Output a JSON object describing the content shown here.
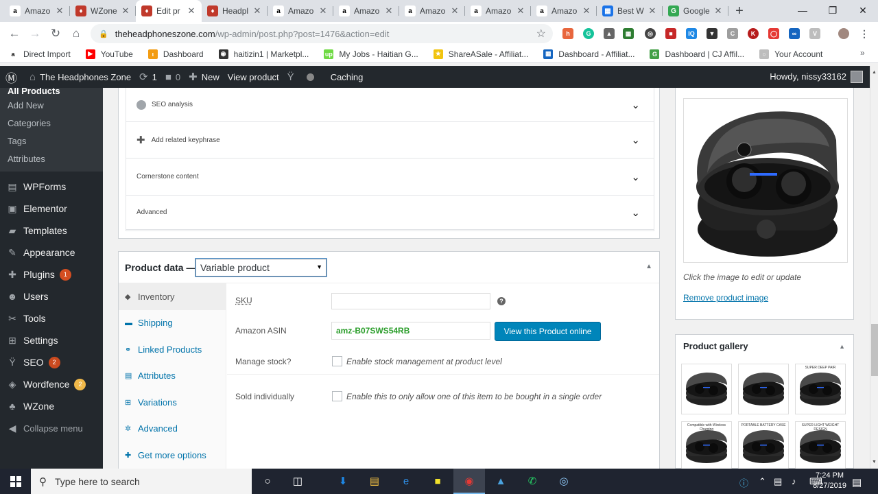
{
  "browser": {
    "tabs": [
      {
        "title": "Amazo",
        "icon": "amazon-icon",
        "color": "#ffffff",
        "glyph": "a",
        "fg": "#000000"
      },
      {
        "title": "WZone",
        "icon": "wzone-icon",
        "color": "#c0392b",
        "glyph": "♦",
        "fg": "#ffffff"
      },
      {
        "title": "Edit pr",
        "icon": "wzone-icon",
        "color": "#c0392b",
        "glyph": "♦",
        "fg": "#ffffff",
        "active": true
      },
      {
        "title": "Headpl",
        "icon": "wzone-icon",
        "color": "#c0392b",
        "glyph": "♦",
        "fg": "#ffffff"
      },
      {
        "title": "Amazo",
        "icon": "amazon-icon",
        "color": "#ffffff",
        "glyph": "a",
        "fg": "#000000"
      },
      {
        "title": "Amazo",
        "icon": "amazon-icon",
        "color": "#ffffff",
        "glyph": "a",
        "fg": "#000000"
      },
      {
        "title": "Amazo",
        "icon": "amazon-icon",
        "color": "#ffffff",
        "glyph": "a",
        "fg": "#000000"
      },
      {
        "title": "Amazo",
        "icon": "amazon-icon",
        "color": "#ffffff",
        "glyph": "a",
        "fg": "#000000"
      },
      {
        "title": "Amazo",
        "icon": "amazon-icon",
        "color": "#ffffff",
        "glyph": "a",
        "fg": "#000000"
      },
      {
        "title": "Best W",
        "icon": "best-icon",
        "color": "#1a73e8",
        "glyph": "▦",
        "fg": "#ffffff"
      },
      {
        "title": "Google",
        "icon": "google-icon",
        "color": "#34a853",
        "glyph": "G",
        "fg": "#ffffff"
      }
    ],
    "url_host": "theheadphoneszone.com",
    "url_path": "/wp-admin/post.php?post=1476&action=edit",
    "bookmarks": [
      {
        "label": "Direct Import",
        "color": "#ffffff",
        "glyph": "a",
        "fg": "#000000"
      },
      {
        "label": "YouTube",
        "color": "#ff0000",
        "glyph": "▶",
        "fg": "#ffffff"
      },
      {
        "label": "Dashboard",
        "color": "#f39c12",
        "glyph": "ι",
        "fg": "#ffffff"
      },
      {
        "label": "haitizin1 | Marketpl...",
        "color": "#333333",
        "glyph": "◉",
        "fg": "#ffffff"
      },
      {
        "label": "My Jobs - Haitian G...",
        "color": "#6fda44",
        "glyph": "up",
        "fg": "#ffffff"
      },
      {
        "label": "ShareASale - Affiliat...",
        "color": "#f1c40f",
        "glyph": "★",
        "fg": "#ffffff"
      },
      {
        "label": "Dashboard - Affiliat...",
        "color": "#1565c0",
        "glyph": "▦",
        "fg": "#ffffff"
      },
      {
        "label": "Dashboard | CJ Affil...",
        "color": "#43a047",
        "glyph": "G",
        "fg": "#ffffff"
      },
      {
        "label": "Your Account",
        "color": "#bdbdbd",
        "glyph": "○",
        "fg": "#ffffff"
      }
    ]
  },
  "adminbar": {
    "site_name": "The Headphones Zone",
    "updates_count": "1",
    "comments_count": "0",
    "new_label": "New",
    "view_label": "View product",
    "caching_label": "Caching",
    "howdy": "Howdy, nissy33162"
  },
  "sidebar": {
    "submenu": [
      {
        "label": "All Products",
        "current": true
      },
      {
        "label": "Add New"
      },
      {
        "label": "Categories"
      },
      {
        "label": "Tags"
      },
      {
        "label": "Attributes"
      }
    ],
    "items": [
      {
        "label": "WPForms",
        "icon": "wpforms-icon",
        "glyph": "▤"
      },
      {
        "label": "Elementor",
        "icon": "elementor-icon",
        "glyph": "▣"
      },
      {
        "label": "Templates",
        "icon": "templates-icon",
        "glyph": "▰"
      },
      {
        "label": "Appearance",
        "icon": "appearance-icon",
        "glyph": "✎"
      },
      {
        "label": "Plugins",
        "icon": "plugins-icon",
        "glyph": "✚",
        "badge": "1",
        "badge_color": "#d54e21"
      },
      {
        "label": "Users",
        "icon": "users-icon",
        "glyph": "☻"
      },
      {
        "label": "Tools",
        "icon": "tools-icon",
        "glyph": "✂"
      },
      {
        "label": "Settings",
        "icon": "settings-icon",
        "glyph": "⊞"
      },
      {
        "label": "SEO",
        "icon": "yoast-icon",
        "glyph": "Ÿ",
        "badge": "2",
        "badge_color": "#ca4a1f"
      },
      {
        "label": "Wordfence",
        "icon": "wordfence-icon",
        "glyph": "◈",
        "badge": "2",
        "badge_color": "#f0b849"
      },
      {
        "label": "WZone",
        "icon": "wzone-icon",
        "glyph": "♣"
      },
      {
        "label": "Collapse menu",
        "icon": "collapse-icon",
        "glyph": "◀",
        "collapse": true
      }
    ]
  },
  "seo": {
    "rows": [
      {
        "label": "SEO analysis",
        "kind": "dot"
      },
      {
        "label": "Add related keyphrase",
        "kind": "plus"
      },
      {
        "label": "Cornerstone content",
        "kind": "none"
      },
      {
        "label": "Advanced",
        "kind": "none"
      }
    ]
  },
  "product_data": {
    "title": "Product data —",
    "type_value": "Variable product",
    "tabs": [
      {
        "label": "Inventory",
        "icon": "tag-icon",
        "glyph": "◆",
        "active": true
      },
      {
        "label": "Shipping",
        "icon": "truck-icon",
        "glyph": "▬"
      },
      {
        "label": "Linked Products",
        "icon": "link-icon",
        "glyph": "⚭"
      },
      {
        "label": "Attributes",
        "icon": "table-icon",
        "glyph": "▤"
      },
      {
        "label": "Variations",
        "icon": "grid-icon",
        "glyph": "⊞"
      },
      {
        "label": "Advanced",
        "icon": "gear-icon",
        "glyph": "✲"
      },
      {
        "label": "Get more options",
        "icon": "plugin-icon",
        "glyph": "✚"
      }
    ],
    "sku_label": "SKU",
    "sku_value": "",
    "help_glyph": "?",
    "asin_label": "Amazon ASIN",
    "asin_value": "amz-B07SWS54RB",
    "view_online_label": "View this Product online",
    "manage_stock_label": "Manage stock?",
    "manage_stock_text": "Enable stock management at product level",
    "sold_individually_label": "Sold individually",
    "sold_individually_text": "Enable this to only allow one of this item to be bought in a single order"
  },
  "product_image": {
    "hint": "Click the image to edit or update",
    "remove_label": "Remove product image"
  },
  "gallery": {
    "title": "Product gallery",
    "thumbs": [
      {
        "caption": ""
      },
      {
        "caption": ""
      },
      {
        "caption": "SUPER DEEP PAIR"
      },
      {
        "caption": "Compatible with Wireless Charging"
      },
      {
        "caption": "PORTABLE BATTERY CASE"
      },
      {
        "caption": "SUPER LIGHT WEIGHT DESIGN"
      }
    ]
  },
  "taskbar": {
    "search_placeholder": "Type here to search",
    "time": "7:24 PM",
    "date": "8/27/2019"
  }
}
